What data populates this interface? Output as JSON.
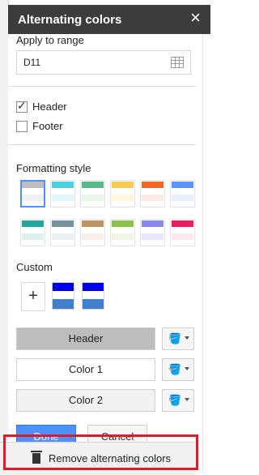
{
  "titlebar": {
    "title": "Alternating colors",
    "close_label": "×"
  },
  "range": {
    "label": "Apply to range",
    "value": "D11"
  },
  "options": {
    "header": {
      "label": "Header",
      "checked": true
    },
    "footer": {
      "label": "Footer",
      "checked": false
    }
  },
  "formatting": {
    "label": "Formatting style",
    "styles": [
      {
        "header": "#bdbdbd",
        "band": "#f1f1f1",
        "selected": true
      },
      {
        "header": "#4dd0e1",
        "band": "#e0f7fa",
        "selected": false
      },
      {
        "header": "#57bb8a",
        "band": "#e8f5e9",
        "selected": false
      },
      {
        "header": "#f7cb4d",
        "band": "#fff8e1",
        "selected": false
      },
      {
        "header": "#f46524",
        "band": "#fbe9e7",
        "selected": false
      },
      {
        "header": "#5b95f9",
        "band": "#e8f0fe",
        "selected": false
      },
      {
        "header": "#26a69a",
        "band": "#ddf2f0",
        "selected": false
      },
      {
        "header": "#78909c",
        "band": "#ebeff1",
        "selected": false
      },
      {
        "header": "#bf9264",
        "band": "#f6efe8",
        "selected": false
      },
      {
        "header": "#8bc34a",
        "band": "#eef7e3",
        "selected": false
      },
      {
        "header": "#8989eb",
        "band": "#e8e7fc",
        "selected": false
      },
      {
        "header": "#e91e63",
        "band": "#fde8ef",
        "selected": false
      }
    ]
  },
  "custom": {
    "label": "Custom",
    "add_label": "+"
  },
  "colors": {
    "header": {
      "label": "Header",
      "color": "#bdbdbd"
    },
    "color1": {
      "label": "Color 1",
      "color": "#ffffff"
    },
    "color2": {
      "label": "Color 2",
      "color": "#f1f1f1"
    }
  },
  "footer_buttons": {
    "done_label": "Done",
    "cancel_label": "Cancel"
  },
  "remove": {
    "label": "Remove alternating colors"
  }
}
